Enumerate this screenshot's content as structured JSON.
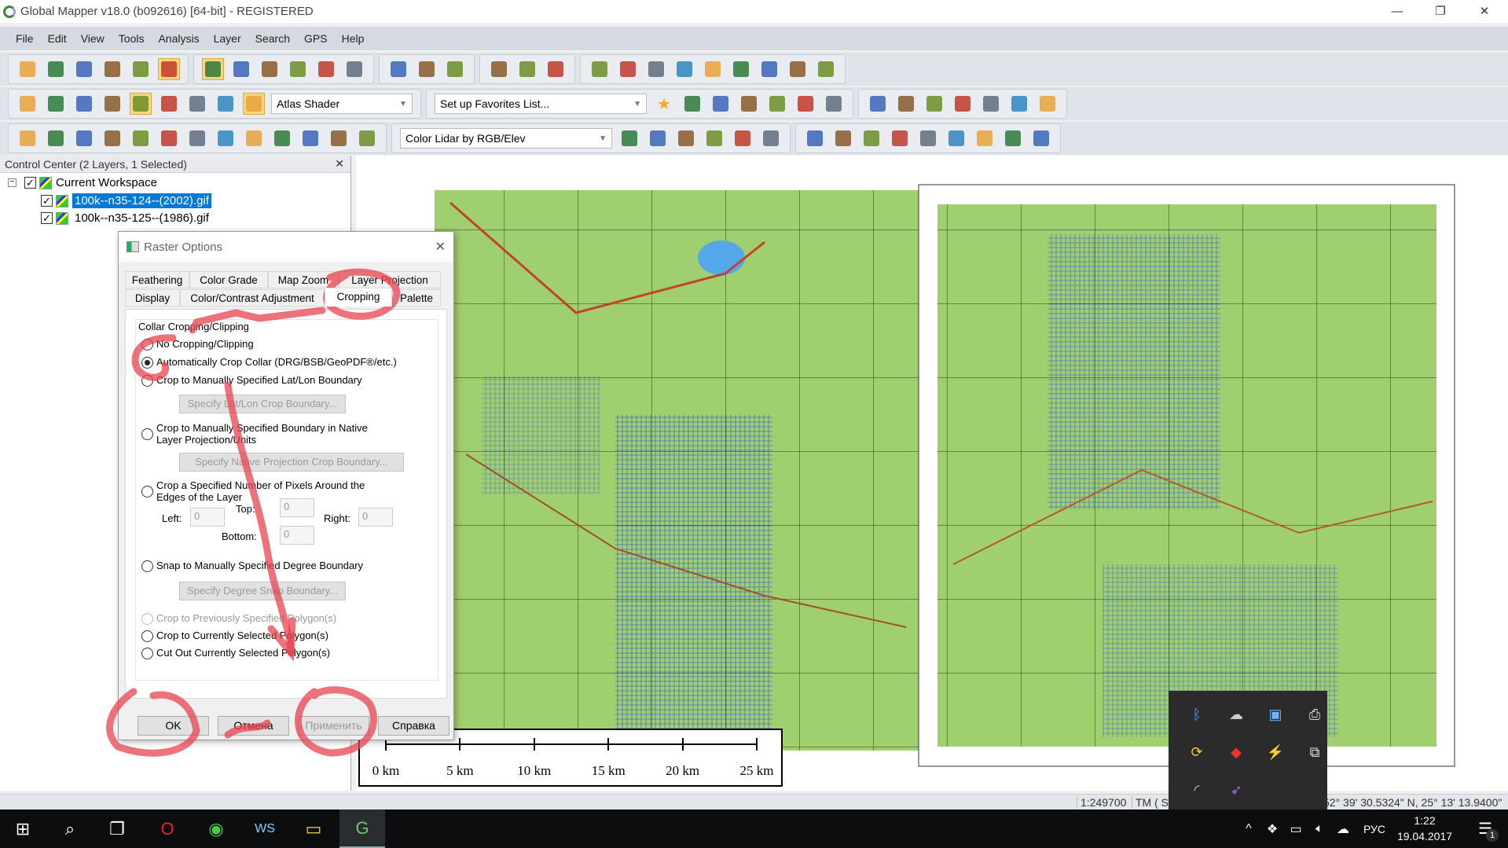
{
  "window": {
    "title": "Global Mapper v18.0 (b092616) [64-bit] - REGISTERED",
    "minimize": "—",
    "maximize": "❐",
    "close": "✕"
  },
  "menu": [
    "File",
    "Edit",
    "View",
    "Tools",
    "Analysis",
    "Layer",
    "Search",
    "GPS",
    "Help"
  ],
  "toolbars": {
    "row1": [
      [
        "open-folder-icon",
        "globe-icon",
        "save-icon",
        "print-icon",
        "wrench-icon",
        "layers-icon"
      ],
      [
        "zoom-tool-icon",
        "pan-hand-icon",
        "zoom-in-icon",
        "zoom-out-icon",
        "back-arrow-icon",
        "home-icon"
      ],
      [
        "pencil-icon",
        "select-rect-icon",
        "delete-x-icon"
      ],
      [
        "ruler-icon",
        "info-icon",
        "search-doc-icon"
      ],
      [
        "terrain-icon",
        "contour-icon",
        "view-shed-icon",
        "profile-icon",
        "watershed-icon",
        "water-drop-icon",
        "cut-fill-icon",
        "elevation-grid-icon",
        "tools-cross-icon"
      ]
    ],
    "row2": [
      [
        "panel-icon",
        "cursor-icon",
        "split-icon",
        "3d-icon",
        "transparency-icon",
        "water-level-icon",
        "water-level2-icon",
        "flood-icon",
        "shader-icon"
      ],
      [
        "line-draw-icon",
        "line-edit-icon",
        "freehand-icon",
        "area-draw-icon",
        "point-draw-icon",
        "circle-draw-icon"
      ],
      [
        "measure-icon",
        "target-icon",
        "grid-icon",
        "pin-icon",
        "area-icon",
        "edit-line-icon",
        "edit-line2-icon"
      ]
    ],
    "row3": [
      [
        "move-icon",
        "rotate-icon",
        "vertex-icon",
        "move-vertex-icon",
        "delete-vertex-icon",
        "connect-icon",
        "split-line-icon",
        "join-icon",
        "rotate-feature-icon",
        "scale-feature-icon",
        "copy-icon",
        "crop-icon",
        "eraser-icon"
      ],
      [
        "lidar-classify-icon",
        "lidar-ground-icon",
        "lidar-settings-icon",
        "lidar-noise-icon",
        "filter-icon",
        "lidar-edit-icon"
      ],
      [
        "mountain-icon",
        "grass-icon",
        "bush-icon",
        "tree-icon",
        "building-icon",
        "powerline-icon",
        "water-icon",
        "dots-icon",
        "lidar-pen-icon"
      ]
    ]
  },
  "shader_combo": "Atlas Shader",
  "favorites_combo": "Set up Favorites List...",
  "lidar_combo": "Color Lidar by RGB/Elev",
  "control_center": {
    "title": "Control Center (2 Layers, 1 Selected)",
    "workspace": "Current Workspace",
    "layers": [
      "100k--n35-124--(2002).gif",
      "100k--n35-125--(1986).gif"
    ]
  },
  "dialog": {
    "title": "Raster Options",
    "tabs_row1": [
      "Feathering",
      "Color Grade",
      "Map Zoom",
      "Layer Projection"
    ],
    "tabs_row2": [
      "Display",
      "Color/Contrast Adjustment",
      "Cropping",
      "Palette"
    ],
    "group": "Collar Cropping/Clipping",
    "options": [
      "No Cropping/Clipping",
      "Automatically Crop Collar (DRG/BSB/GeoPDF®/etc.)",
      "Crop to Manually Specified Lat/Lon Boundary",
      "Crop to Manually Specified Boundary in Native Layer Projection/Units",
      "Crop a Specified Number of Pixels Around the Edges of the Layer",
      "Snap to Manually Specified Degree Boundary",
      "Crop to Previously Specified Polygon(s)",
      "Crop to Currently Selected Polygon(s)",
      "Cut Out Currently Selected Polygon(s)"
    ],
    "selected_option": "Automatically Crop Collar (DRG/BSB/GeoPDF®/etc.)",
    "btn_latlon": "Specify Lat/Lon Crop Boundary...",
    "btn_native": "Specify Native Projection Crop Boundary...",
    "btn_degree": "Specify Degree Snap Boundary...",
    "left_label": "Left:",
    "top_label": "Top:",
    "right_label": "Right:",
    "bottom_label": "Bottom:",
    "left": "0",
    "top": "0",
    "right": "0",
    "bottom": "0",
    "ok": "OK",
    "cancel": "Отмена",
    "apply": "Применить",
    "help": "Справка"
  },
  "scale_bar": [
    "0 km",
    "5 km",
    "10 km",
    "15 km",
    "20 km",
    "25 km"
  ],
  "status": {
    "scale": "1:249700",
    "projection": "TM ( S-4",
    "coords": "52° 39' 30.5324\" N, 25° 13' 13.9400\" E"
  },
  "taskbar": {
    "language": "РУС",
    "time": "1:22",
    "date": "19.04.2017",
    "notifications": "1"
  },
  "colors": {
    "map_green": "#9fcf6e",
    "selection": "#0078d7",
    "annotation": "#e8434f"
  }
}
